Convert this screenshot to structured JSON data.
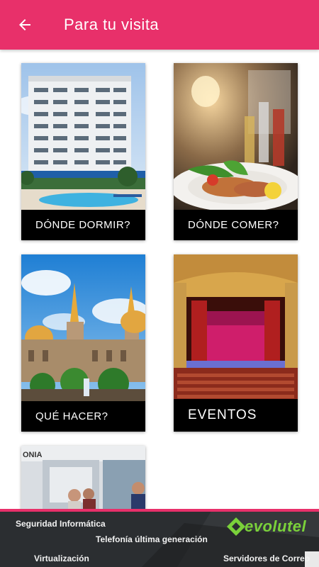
{
  "header": {
    "title": "Para tu visita",
    "back_icon": "arrow-back-icon",
    "background_color": "#e8306a"
  },
  "cards": [
    {
      "label": "DÓNDE DORMIR?",
      "image": "hotel-photo"
    },
    {
      "label": "DÓNDE COMER?",
      "image": "food-photo"
    },
    {
      "label": "QUÉ HACER?",
      "image": "cathedral-photo"
    },
    {
      "label": "EVENTOS",
      "image": "theater-photo"
    },
    {
      "label": "",
      "image": "shopping-photo"
    }
  ],
  "ad": {
    "line1": "Seguridad Informática",
    "line2": "Telefonía última generación",
    "line3": "Virtualización",
    "line4": "Servidores de Correo",
    "brand": "evolutel",
    "brand_color": "#7ad13a"
  }
}
